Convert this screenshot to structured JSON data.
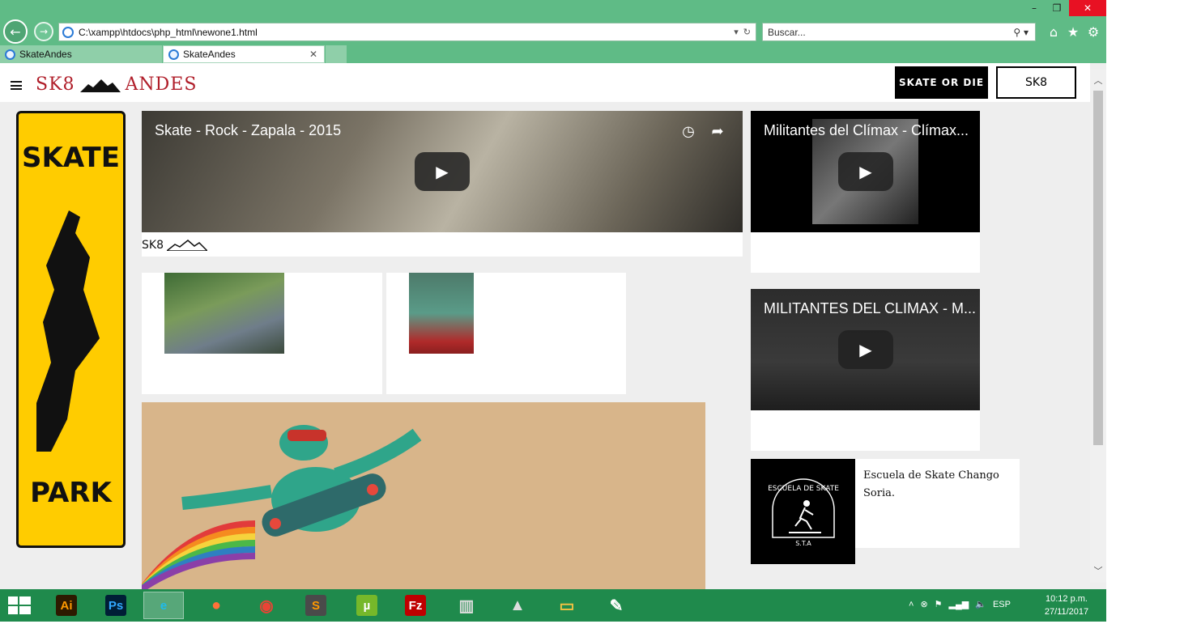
{
  "browser": {
    "address_url": "C:\\xampp\\htdocs\\php_html\\newone1.html",
    "search_placeholder": "Buscar...",
    "tabs": [
      {
        "label": "SkateAndes"
      },
      {
        "label": "SkateAndes"
      }
    ],
    "window_controls": {
      "minimize": "–",
      "restore": "❐",
      "close": "✕"
    }
  },
  "site": {
    "brand_left": "SK8",
    "brand_right": "ANDES",
    "nav_buttons": [
      {
        "label": "SKATE OR DIE"
      },
      {
        "label": "SK8"
      }
    ],
    "sign_words": [
      "SKATE",
      "PARK"
    ],
    "videos": [
      {
        "title": "Skate - Rock - Zapala - 2015"
      },
      {
        "title": "Militantes del Clímax - Clímax..."
      },
      {
        "title": "MILITANTES DEL CLIMAX - M..."
      }
    ],
    "video_caption": "SK8",
    "school_description": "Escuela de Skate Chango Soria.",
    "school_logo_text": {
      "top": "ESCUELA DE SKATE",
      "bottom": "S.T.A"
    }
  },
  "taskbar": {
    "apps": [
      {
        "name": "Ai",
        "color": "#ff9a00",
        "bg": "#2d1a00"
      },
      {
        "name": "Ps",
        "color": "#31a8ff",
        "bg": "#001e36"
      },
      {
        "name": "e",
        "color": "#1ebbee",
        "bg": "transparent"
      },
      {
        "name": "firefox",
        "color": "#ff7139",
        "bg": "transparent"
      },
      {
        "name": "chrome",
        "color": "#ea4335",
        "bg": "transparent"
      },
      {
        "name": "S",
        "color": "#ff9800",
        "bg": "#4a4a4a"
      },
      {
        "name": "µ",
        "color": "#ffffff",
        "bg": "#76b82a"
      },
      {
        "name": "Fz",
        "color": "#ffffff",
        "bg": "#bf0000"
      },
      {
        "name": "server",
        "color": "#dddddd",
        "bg": "transparent"
      },
      {
        "name": "bell",
        "color": "#dddddd",
        "bg": "transparent"
      },
      {
        "name": "folder",
        "color": "#f5c342",
        "bg": "transparent"
      },
      {
        "name": "paint",
        "color": "#ffffff",
        "bg": "transparent"
      }
    ],
    "lang": "ESP",
    "time": "10:12 p.m.",
    "date": "27/11/2017"
  }
}
